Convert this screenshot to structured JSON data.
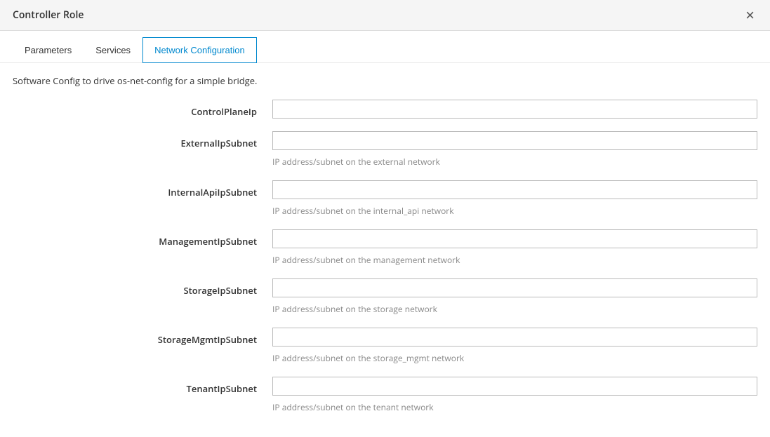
{
  "header": {
    "title": "Controller Role",
    "close_label": "×"
  },
  "tabs": [
    {
      "label": "Parameters",
      "active": false
    },
    {
      "label": "Services",
      "active": false
    },
    {
      "label": "Network Configuration",
      "active": true
    }
  ],
  "form": {
    "description": "Software Config to drive os-net-config for a simple bridge.",
    "fields": [
      {
        "name": "ControlPlaneIp",
        "label": "ControlPlaneIp",
        "value": "",
        "help": ""
      },
      {
        "name": "ExternalIpSubnet",
        "label": "ExternalIpSubnet",
        "value": "",
        "help": "IP address/subnet on the external network"
      },
      {
        "name": "InternalApiIpSubnet",
        "label": "InternalApiIpSubnet",
        "value": "",
        "help": "IP address/subnet on the internal_api network"
      },
      {
        "name": "ManagementIpSubnet",
        "label": "ManagementIpSubnet",
        "value": "",
        "help": "IP address/subnet on the management network"
      },
      {
        "name": "StorageIpSubnet",
        "label": "StorageIpSubnet",
        "value": "",
        "help": "IP address/subnet on the storage network"
      },
      {
        "name": "StorageMgmtIpSubnet",
        "label": "StorageMgmtIpSubnet",
        "value": "",
        "help": "IP address/subnet on the storage_mgmt network"
      },
      {
        "name": "TenantIpSubnet",
        "label": "TenantIpSubnet",
        "value": "",
        "help": "IP address/subnet on the tenant network"
      }
    ]
  }
}
